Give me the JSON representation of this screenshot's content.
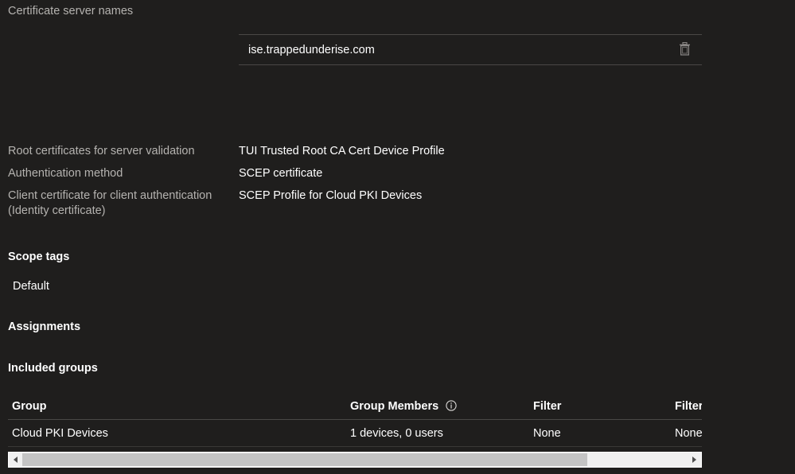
{
  "certificate_server_names": {
    "caption": "Certificate server names",
    "entry_value": "ise.trappedunderise.com",
    "entry_placeholder": "",
    "delete_icon": "trash-icon"
  },
  "details": [
    {
      "label": "Root certificates for server validation",
      "value": "TUI Trusted Root CA Cert Device Profile"
    },
    {
      "label": "Authentication method",
      "value": "SCEP certificate"
    },
    {
      "label": "Client certificate for client authentication (Identity certificate)",
      "value": "SCEP Profile for Cloud PKI Devices"
    }
  ],
  "scope_tags": {
    "title": "Scope tags",
    "value": "Default"
  },
  "assignments": {
    "title": "Assignments"
  },
  "included_groups": {
    "title": "Included groups",
    "columns": [
      {
        "label": "Group",
        "info_icon": ""
      },
      {
        "label": "Group Members",
        "info_icon": "info-icon"
      },
      {
        "label": "Filter",
        "info_icon": ""
      },
      {
        "label": "Filter",
        "info_icon": ""
      }
    ],
    "rows": [
      {
        "group": "Cloud PKI Devices",
        "members": "1 devices, 0 users",
        "filter1": "None",
        "filter2": "None"
      }
    ]
  },
  "scrollbar": {
    "left_arrow_icon": "arrow-left-icon",
    "right_arrow_icon": "arrow-right-icon",
    "orientation": "horizontal"
  },
  "colors": {
    "background": "#1f1e1d",
    "label_text": "#b5b3b0",
    "value_text": "#ffffff",
    "divider": "#4a4846",
    "scrollbar_track": "#f0f0f0",
    "scrollbar_thumb": "#c4c4c4"
  }
}
